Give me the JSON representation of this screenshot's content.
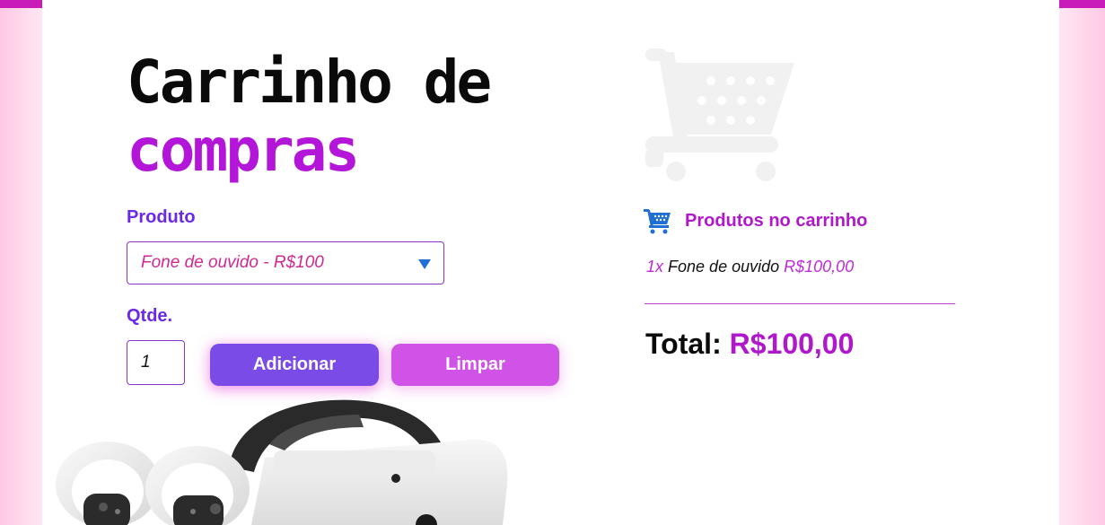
{
  "heading": {
    "line1": "Carrinho de",
    "line2": "compras"
  },
  "form": {
    "product_label": "Produto",
    "product_selected": "Fone de ouvido - R$100",
    "qty_label": "Qtde.",
    "qty_value": "1",
    "add_button": "Adicionar",
    "clear_button": "Limpar"
  },
  "cart": {
    "title": "Produtos no carrinho",
    "items": [
      {
        "qty": "1x",
        "name": "Fone de ouvido",
        "price": "R$100,00"
      }
    ],
    "total_label": "Total:",
    "total_value": "R$100,00"
  },
  "icons": {
    "cart_big": "shopping-cart-icon",
    "cart_small": "shopping-cart-icon",
    "select_caret": "triangle-down-icon"
  },
  "colors": {
    "accent_purple": "#b316d8",
    "label_purple": "#6a2ae6",
    "button_add": "#7a4be6",
    "button_clear": "#d052e6",
    "cart_icon_blue": "#1f6fd4"
  }
}
